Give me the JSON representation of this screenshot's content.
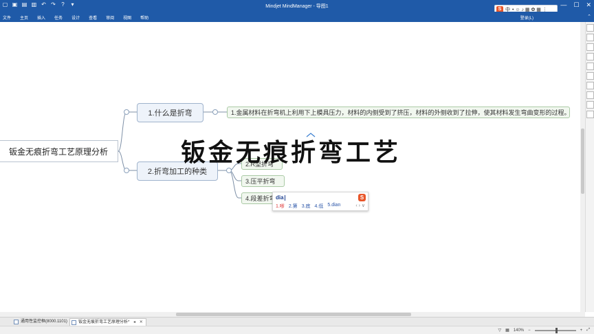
{
  "window": {
    "title": "Mindjet MindManager - 导图1",
    "controls": [
      "—",
      "☐",
      "✕"
    ]
  },
  "ime_toolbar": {
    "mode": "中",
    "symbols": "• ☺ ♪ ▦ ✿ ▦ ⋮"
  },
  "menu": {
    "tabs": [
      "文件",
      "主页",
      "插入",
      "任务",
      "设计",
      "查看",
      "审阅",
      "视图",
      "帮助"
    ],
    "user": "登录(L)"
  },
  "mindmap": {
    "central": "钣金无痕折弯工艺原理分析",
    "topic1": {
      "label": "1.什么是折弯",
      "subtopics": [
        "1.金属材料在折弯机上利用下上模具压力，材料的内侧受到了挤压，材料的外侧收到了拉伸，使其材料发生弯曲变形的过程。"
      ]
    },
    "topic2": {
      "label": "2.折弯加工的种类",
      "subtopics": [
        "2.R型折弯",
        "3.压平折弯",
        "4.段差折弯"
      ]
    }
  },
  "overlay_title": "钣金无痕折弯工艺",
  "ime_popup": {
    "input": "dia",
    "logo": "S",
    "candidates": [
      "1.嗲",
      "2.第",
      "3.底",
      "4.低",
      "5.dian"
    ],
    "nav": "‹ › ∨"
  },
  "doc_tabs": [
    {
      "label": "通用性监控框(8000.1101)"
    },
    {
      "label": "钣金无痕折弯工艺原理分析*",
      "pin": "◂",
      "close": "✕"
    }
  ],
  "status": {
    "zoom": "140%"
  }
}
